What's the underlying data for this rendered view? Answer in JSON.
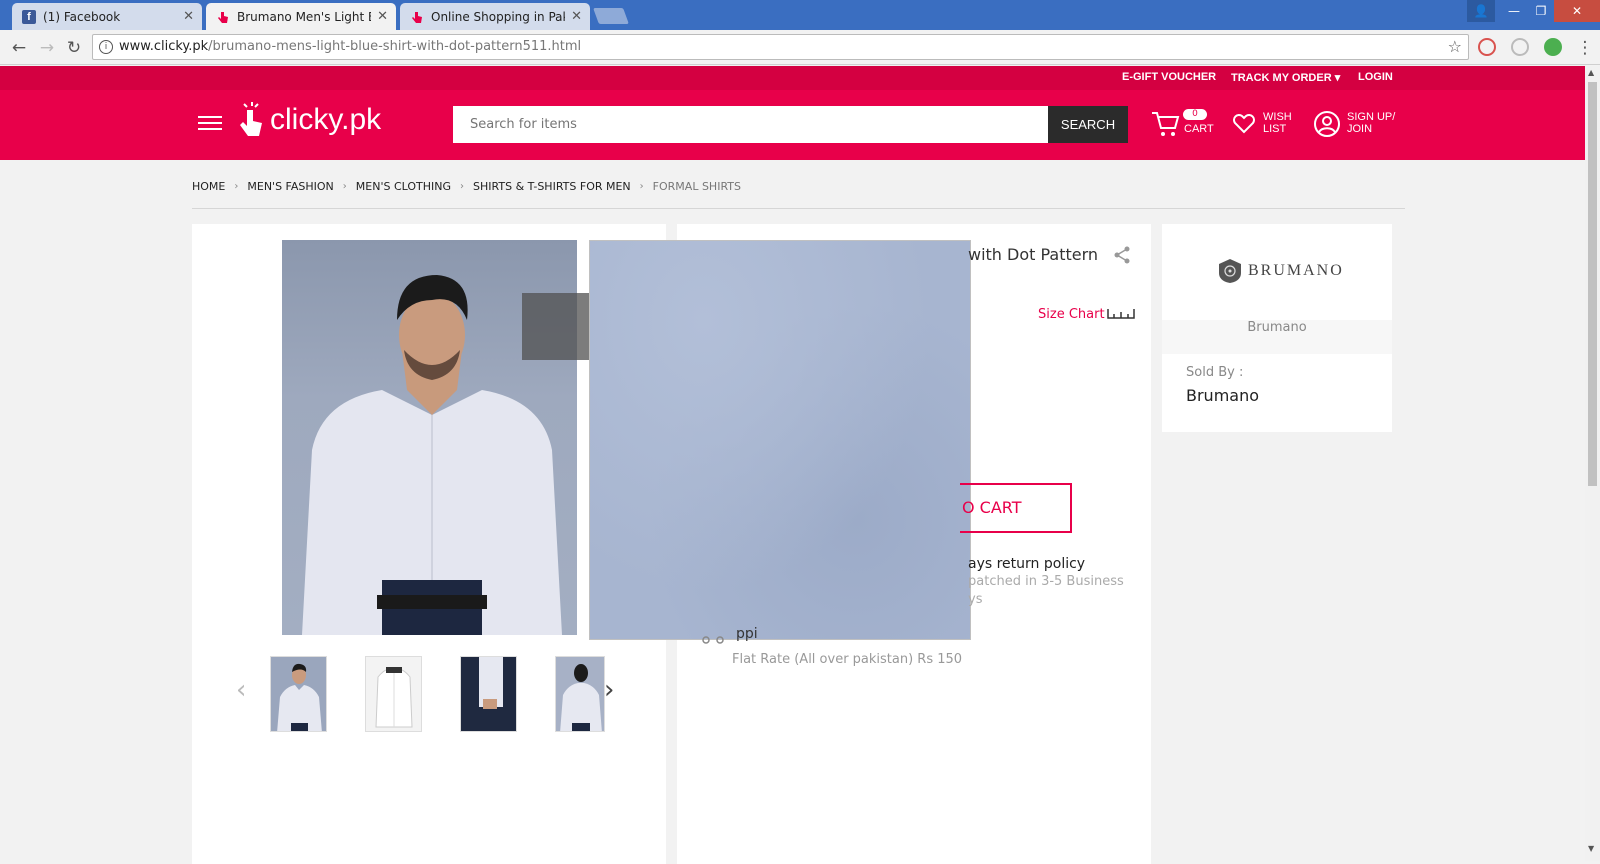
{
  "browser": {
    "tabs": [
      {
        "title": "(1) Facebook",
        "active": false
      },
      {
        "title": "Brumano Men's Light Blu",
        "active": true
      },
      {
        "title": "Online Shopping in Pakis",
        "active": false
      }
    ],
    "url_host": "www.clicky.pk",
    "url_path": "/brumano-mens-light-blue-shirt-with-dot-pattern511.html"
  },
  "site": {
    "top_links": {
      "gift": "E-GIFT VOUCHER",
      "track": "TRACK MY ORDER",
      "login": "LOGIN"
    },
    "logo_text": "clicky.pk",
    "search": {
      "placeholder": "Search for items",
      "button": "SEARCH"
    },
    "cart": {
      "count": "0",
      "label": "CART"
    },
    "wishlist": {
      "line1": "WISH",
      "line2": "LIST"
    },
    "account": {
      "line1": "SIGN UP/",
      "line2": "JOIN"
    },
    "brand_color": "#e8004a"
  },
  "breadcrumb": [
    "HOME",
    "MEN'S FASHION",
    "MEN'S CLOTHING",
    "SHIRTS & T-SHIRTS FOR MEN",
    "FORMAL SHIRTS"
  ],
  "product": {
    "title_visible": "with Dot Pattern",
    "size_chart": "Size Chart",
    "add_to_cart_visible": "O CART",
    "return_policy_visible": "ays return policy",
    "dispatch_line1": "patched in 3-5 Business",
    "dispatch_line2": "ys",
    "shipping_visible": "ppi",
    "flat_rate": "Flat Rate (All over pakistan) Rs 150"
  },
  "seller": {
    "brand_logo_text": "BRUMANO",
    "brand_name": "Brumano",
    "sold_by_label": "Sold By :",
    "sold_by_value": "Brumano"
  }
}
